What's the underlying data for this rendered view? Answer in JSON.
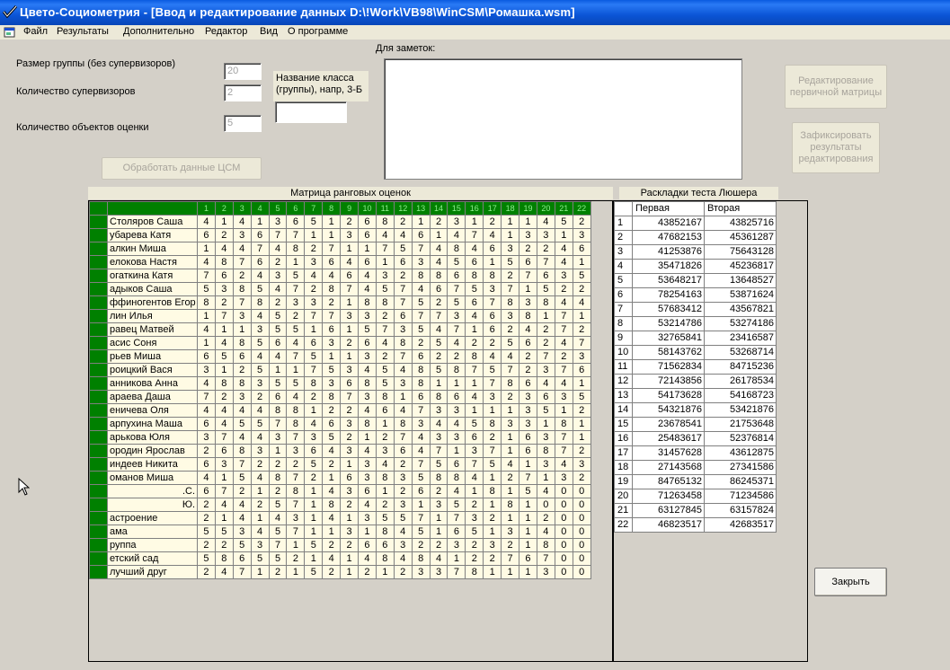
{
  "window": {
    "title": "Цвето-Социометрия - [Ввод  и редактирование данных D:\\!Work\\VB98\\WinCSM\\Ромашка.wsm]"
  },
  "menu": [
    "Файл",
    "Результаты",
    "Дополнительно",
    "Редактор",
    "Вид",
    "О программе"
  ],
  "form": {
    "group_size_label": "Размер группы (без супервизоров)",
    "group_size_value": "20",
    "supervisors_label": "Количество супервизоров",
    "supervisors_value": "2",
    "objects_label": "Количество объектов оценки",
    "objects_value": "5",
    "class_name_label_1": "Название класса",
    "class_name_label_2": "(группы), напр, 3-Б",
    "class_name_value": "",
    "notes_label": "Для заметок:",
    "notes_value": "",
    "process_button": "Обработать данные ЦСМ",
    "edit_primary_button_1": "Редактирование",
    "edit_primary_button_2": "первичной матрицы",
    "fix_results_button_1": "Зафиксировать",
    "fix_results_button_2": "результаты",
    "fix_results_button_3": "редактирования",
    "close_button": "Закрыть"
  },
  "matrix": {
    "title": "Матрица ранговых оценок",
    "rows": [
      {
        "name": "Столяров Саша",
        "align": "left",
        "values": [
          4,
          1,
          4,
          1,
          3,
          6,
          5,
          1,
          2,
          6,
          8,
          2,
          1,
          2,
          3,
          1,
          2,
          1,
          1,
          4,
          5,
          2
        ]
      },
      {
        "name": "убарева Катя",
        "align": "left",
        "values": [
          6,
          2,
          3,
          6,
          7,
          7,
          1,
          1,
          3,
          6,
          4,
          4,
          6,
          1,
          4,
          7,
          4,
          1,
          3,
          3,
          1,
          3
        ]
      },
      {
        "name": "алкин Миша",
        "align": "left",
        "values": [
          1,
          4,
          4,
          7,
          4,
          8,
          2,
          7,
          1,
          1,
          7,
          5,
          7,
          4,
          8,
          4,
          6,
          3,
          2,
          2,
          4,
          6
        ]
      },
      {
        "name": "елокова Настя",
        "align": "left",
        "values": [
          4,
          8,
          7,
          6,
          2,
          1,
          3,
          6,
          4,
          6,
          1,
          6,
          3,
          4,
          5,
          6,
          1,
          5,
          6,
          7,
          4,
          1
        ]
      },
      {
        "name": "огаткина Катя",
        "align": "left",
        "values": [
          7,
          6,
          2,
          4,
          3,
          5,
          4,
          4,
          6,
          4,
          3,
          2,
          8,
          8,
          6,
          8,
          8,
          2,
          7,
          6,
          3,
          5
        ]
      },
      {
        "name": "адыков Саша",
        "align": "left",
        "values": [
          5,
          3,
          8,
          5,
          4,
          7,
          2,
          8,
          7,
          4,
          5,
          7,
          4,
          6,
          7,
          5,
          3,
          7,
          1,
          5,
          2,
          2
        ]
      },
      {
        "name": "ффиногентов Егор",
        "align": "left",
        "values": [
          8,
          2,
          7,
          8,
          2,
          3,
          3,
          2,
          1,
          8,
          8,
          7,
          5,
          2,
          5,
          6,
          7,
          8,
          3,
          8,
          4,
          4
        ]
      },
      {
        "name": "лин Илья",
        "align": "left",
        "values": [
          1,
          7,
          3,
          4,
          5,
          2,
          7,
          7,
          3,
          3,
          2,
          6,
          7,
          7,
          3,
          4,
          6,
          3,
          8,
          1,
          7,
          1
        ]
      },
      {
        "name": "равец Матвей",
        "align": "left",
        "values": [
          4,
          1,
          1,
          3,
          5,
          5,
          1,
          6,
          1,
          5,
          7,
          3,
          5,
          4,
          7,
          1,
          6,
          2,
          4,
          2,
          7,
          2
        ]
      },
      {
        "name": "асис Соня",
        "align": "left",
        "values": [
          1,
          4,
          8,
          5,
          6,
          4,
          6,
          3,
          2,
          6,
          4,
          8,
          2,
          5,
          4,
          2,
          2,
          5,
          6,
          2,
          4,
          7
        ]
      },
      {
        "name": "рьев Миша",
        "align": "left",
        "values": [
          6,
          5,
          6,
          4,
          4,
          7,
          5,
          1,
          1,
          3,
          2,
          7,
          6,
          2,
          2,
          8,
          4,
          4,
          2,
          7,
          2,
          3
        ]
      },
      {
        "name": "роицкий Вася",
        "align": "left",
        "values": [
          3,
          1,
          2,
          5,
          1,
          1,
          7,
          5,
          3,
          4,
          5,
          4,
          8,
          5,
          8,
          7,
          5,
          7,
          2,
          3,
          7,
          6
        ]
      },
      {
        "name": "анникова Анна",
        "align": "left",
        "values": [
          4,
          8,
          8,
          3,
          5,
          5,
          8,
          3,
          6,
          8,
          5,
          3,
          8,
          1,
          1,
          1,
          7,
          8,
          6,
          4,
          4,
          1
        ]
      },
      {
        "name": "араева Даша",
        "align": "left",
        "values": [
          7,
          2,
          3,
          2,
          6,
          4,
          2,
          8,
          7,
          3,
          8,
          1,
          6,
          8,
          6,
          4,
          3,
          2,
          3,
          6,
          3,
          5
        ]
      },
      {
        "name": "еничева Оля",
        "align": "left",
        "values": [
          4,
          4,
          4,
          4,
          8,
          8,
          1,
          2,
          2,
          4,
          6,
          4,
          7,
          3,
          3,
          1,
          1,
          1,
          3,
          5,
          1,
          2
        ]
      },
      {
        "name": "арпухина Маша",
        "align": "left",
        "values": [
          6,
          4,
          5,
          5,
          7,
          8,
          4,
          6,
          3,
          8,
          1,
          8,
          3,
          4,
          4,
          5,
          8,
          3,
          3,
          1,
          8,
          1
        ]
      },
      {
        "name": "арькова Юля",
        "align": "left",
        "values": [
          3,
          7,
          4,
          4,
          3,
          7,
          3,
          5,
          2,
          1,
          2,
          7,
          4,
          3,
          3,
          6,
          2,
          1,
          6,
          3,
          7,
          1
        ]
      },
      {
        "name": "ородин Ярослав",
        "align": "left",
        "values": [
          2,
          6,
          8,
          3,
          1,
          3,
          6,
          4,
          3,
          4,
          3,
          6,
          4,
          7,
          1,
          3,
          7,
          1,
          6,
          8,
          7,
          2
        ]
      },
      {
        "name": "индеев Никита",
        "align": "left",
        "values": [
          6,
          3,
          7,
          2,
          2,
          2,
          5,
          2,
          1,
          3,
          4,
          2,
          7,
          5,
          6,
          7,
          5,
          4,
          1,
          3,
          4,
          3
        ]
      },
      {
        "name": "оманов Миша",
        "align": "left",
        "values": [
          4,
          1,
          5,
          4,
          8,
          7,
          2,
          1,
          6,
          3,
          8,
          3,
          5,
          8,
          8,
          4,
          1,
          2,
          7,
          1,
          3,
          2
        ]
      },
      {
        "name": ".С.",
        "align": "right",
        "values": [
          6,
          7,
          2,
          1,
          2,
          8,
          1,
          4,
          3,
          6,
          1,
          2,
          6,
          2,
          4,
          1,
          8,
          1,
          5,
          4,
          0,
          0
        ]
      },
      {
        "name": "Ю.",
        "align": "right",
        "values": [
          2,
          4,
          4,
          2,
          5,
          7,
          1,
          8,
          2,
          4,
          2,
          3,
          1,
          3,
          5,
          2,
          1,
          8,
          1,
          0,
          0,
          0
        ]
      },
      {
        "name": "астроение",
        "align": "left",
        "values": [
          2,
          1,
          4,
          1,
          4,
          3,
          1,
          4,
          1,
          3,
          5,
          5,
          7,
          1,
          7,
          3,
          2,
          1,
          1,
          2,
          0,
          0
        ]
      },
      {
        "name": "ама",
        "align": "left",
        "values": [
          5,
          5,
          3,
          4,
          5,
          7,
          1,
          1,
          3,
          1,
          8,
          4,
          5,
          1,
          6,
          5,
          1,
          3,
          1,
          4,
          0,
          0
        ]
      },
      {
        "name": "руппа",
        "align": "left",
        "values": [
          2,
          2,
          5,
          3,
          7,
          1,
          5,
          2,
          2,
          6,
          6,
          3,
          2,
          2,
          3,
          2,
          3,
          2,
          1,
          8,
          0,
          0
        ]
      },
      {
        "name": "етский сад",
        "align": "left",
        "values": [
          5,
          8,
          6,
          5,
          5,
          2,
          1,
          4,
          1,
          4,
          8,
          4,
          8,
          4,
          1,
          2,
          2,
          7,
          6,
          7,
          0,
          0
        ]
      },
      {
        "name": "лучший друг",
        "align": "left",
        "values": [
          2,
          4,
          7,
          1,
          2,
          1,
          5,
          2,
          1,
          2,
          1,
          2,
          3,
          3,
          7,
          8,
          1,
          1,
          1,
          3,
          0,
          0
        ]
      }
    ]
  },
  "luscher": {
    "title": "Раскладки теста Люшера",
    "col_first": "Первая",
    "col_second": "Вторая",
    "rows": [
      {
        "n": "1",
        "a": "43852167",
        "b": "43825716"
      },
      {
        "n": "2",
        "a": "47682153",
        "b": "45361287"
      },
      {
        "n": "3",
        "a": "41253876",
        "b": "75643128"
      },
      {
        "n": "4",
        "a": "35471826",
        "b": "45236817"
      },
      {
        "n": "5",
        "a": "53648217",
        "b": "13648527"
      },
      {
        "n": "6",
        "a": "78254163",
        "b": "53871624"
      },
      {
        "n": "7",
        "a": "57683412",
        "b": "43567821"
      },
      {
        "n": "8",
        "a": "53214786",
        "b": "53274186"
      },
      {
        "n": "9",
        "a": "32765841",
        "b": "23416587"
      },
      {
        "n": "10",
        "a": "58143762",
        "b": "53268714"
      },
      {
        "n": "11",
        "a": "71562834",
        "b": "84715236"
      },
      {
        "n": "12",
        "a": "72143856",
        "b": "26178534"
      },
      {
        "n": "13",
        "a": "54173628",
        "b": "54168723"
      },
      {
        "n": "14",
        "a": "54321876",
        "b": "53421876"
      },
      {
        "n": "15",
        "a": "23678541",
        "b": "21753648"
      },
      {
        "n": "16",
        "a": "25483617",
        "b": "52376814"
      },
      {
        "n": "17",
        "a": "31457628",
        "b": "43612875"
      },
      {
        "n": "18",
        "a": "27143568",
        "b": "27341586"
      },
      {
        "n": "19",
        "a": "84765132",
        "b": "86245371"
      },
      {
        "n": "20",
        "a": "71263458",
        "b": "71234586"
      },
      {
        "n": "21",
        "a": "63127845",
        "b": "63157824"
      },
      {
        "n": "22",
        "a": "46823517",
        "b": "42683517"
      }
    ]
  }
}
